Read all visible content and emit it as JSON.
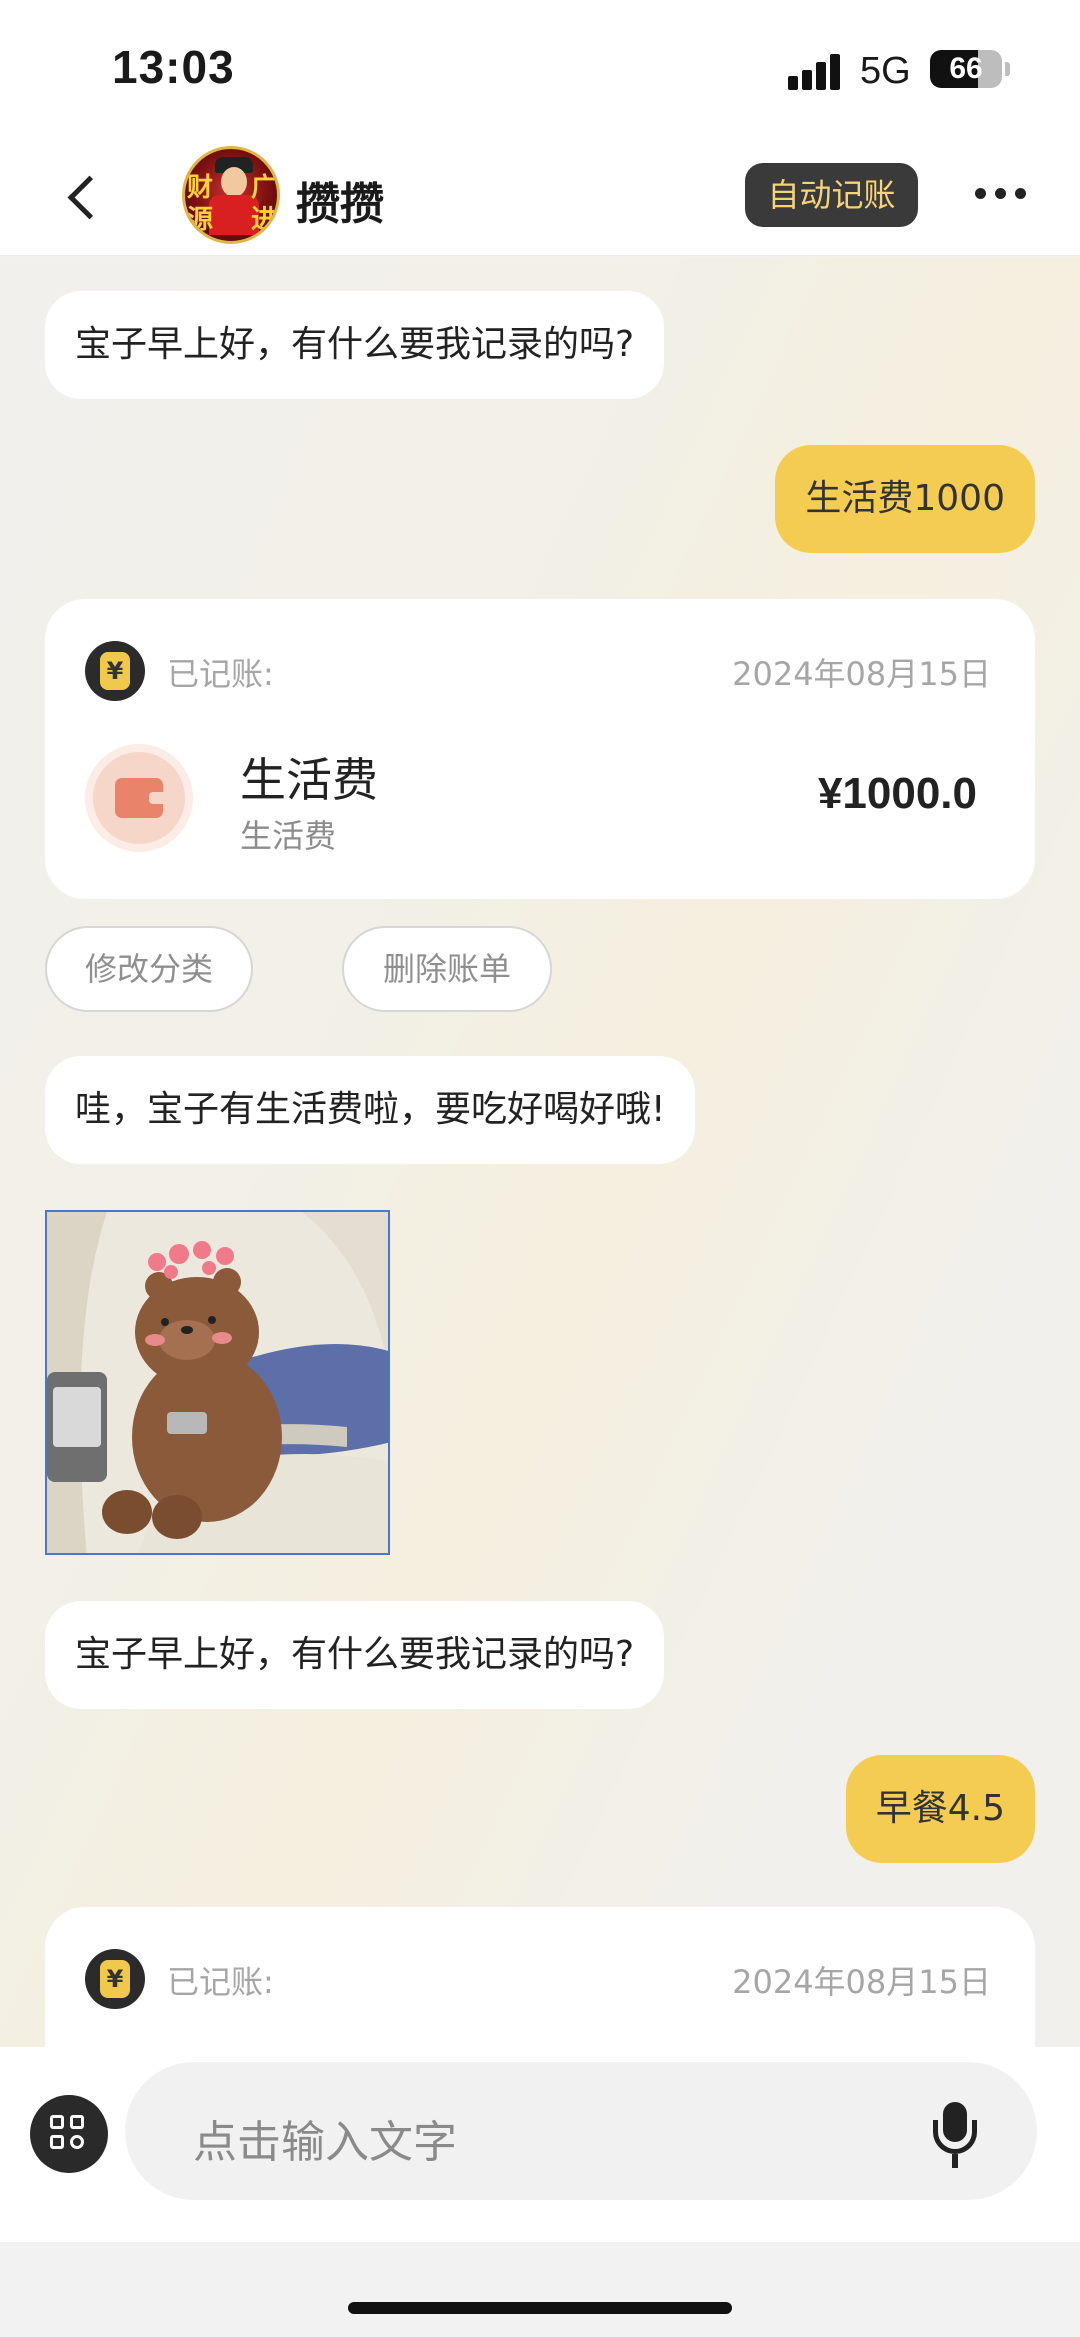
{
  "status_bar": {
    "time": "13:03",
    "network": "5G",
    "battery": "66",
    "battery_level": 0.66
  },
  "header": {
    "title": "攒攒",
    "auto_button": "自动记账",
    "avatar_glyphs": [
      "财",
      "源",
      "广",
      "进"
    ]
  },
  "messages": {
    "greeting_1": "宝子早上好，有什么要我记录的吗?",
    "user_1": "生活费1000",
    "record_1": {
      "label": "已记账:",
      "date": "2024年08月15日",
      "category": "生活费",
      "subcategory": "生活费",
      "amount": "¥1000.0"
    },
    "actions": {
      "edit": "修改分类",
      "delete": "删除账单"
    },
    "reply_1": "哇，宝子有生活费啦，要吃好喝好哦!",
    "sticker": "bear-sticker",
    "greeting_2": "宝子早上好，有什么要我记录的吗?",
    "user_2": "早餐4.5",
    "record_2": {
      "label": "已记账:",
      "date": "2024年08月15日"
    }
  },
  "input": {
    "placeholder": "点击输入文字"
  },
  "colors": {
    "accent": "#f5cc52",
    "dark": "#3a3a3a",
    "auto_text": "#f6d27a"
  }
}
